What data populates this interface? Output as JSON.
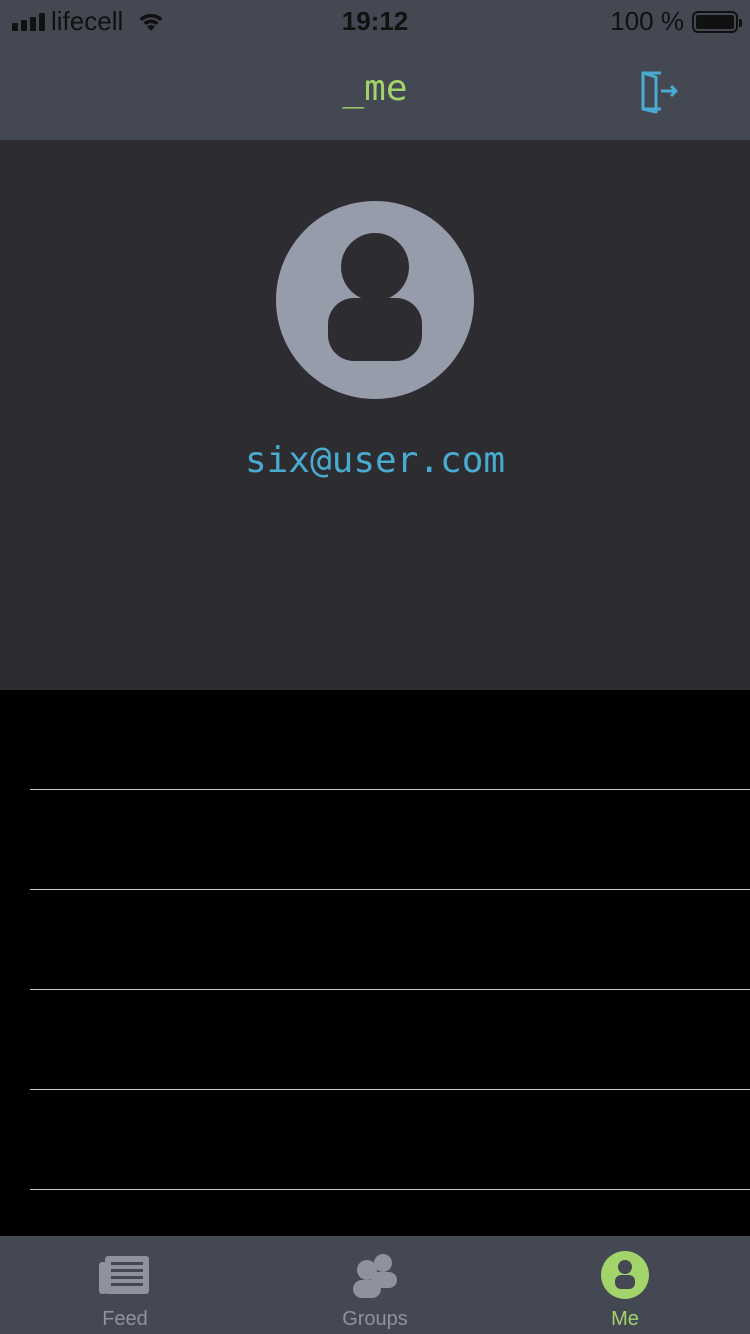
{
  "status_bar": {
    "carrier": "lifecell",
    "time": "19:12",
    "battery": "100 %"
  },
  "nav": {
    "title": "_me",
    "logout_icon": "logout-icon"
  },
  "profile": {
    "avatar_icon": "user-icon",
    "email": "six@user.com"
  },
  "list": {
    "row_count": 5
  },
  "tabs": [
    {
      "label": "Feed",
      "icon": "newspaper-icon",
      "active": false
    },
    {
      "label": "Groups",
      "icon": "group-icon",
      "active": false
    },
    {
      "label": "Me",
      "icon": "user-circle-icon",
      "active": true
    }
  ],
  "colors": {
    "accent_green": "#a3d36b",
    "accent_blue": "#4aabd0",
    "bar_bg": "#444852",
    "header_bg": "#2c2c31",
    "inactive": "#8e929c"
  }
}
